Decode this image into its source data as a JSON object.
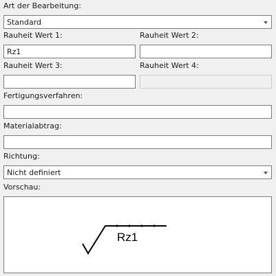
{
  "art": {
    "label": "Art der Bearbeitung:",
    "value": "Standard"
  },
  "rauheit1": {
    "label": "Rauheit Wert 1:",
    "value": "Rz1"
  },
  "rauheit2": {
    "label": "Rauheit Wert 2:",
    "value": ""
  },
  "rauheit3": {
    "label": "Rauheit Wert 3:",
    "value": ""
  },
  "rauheit4": {
    "label": "Rauheit Wert 4:",
    "value": ""
  },
  "fertigung": {
    "label": "Fertigungsverfahren:",
    "value": ""
  },
  "material": {
    "label": "Materialabtrag:",
    "value": ""
  },
  "richtung": {
    "label": "Richtung:",
    "value": "Nicht definiert"
  },
  "vorschau": {
    "label": "Vorschau:",
    "symbol_text": "Rz1"
  }
}
